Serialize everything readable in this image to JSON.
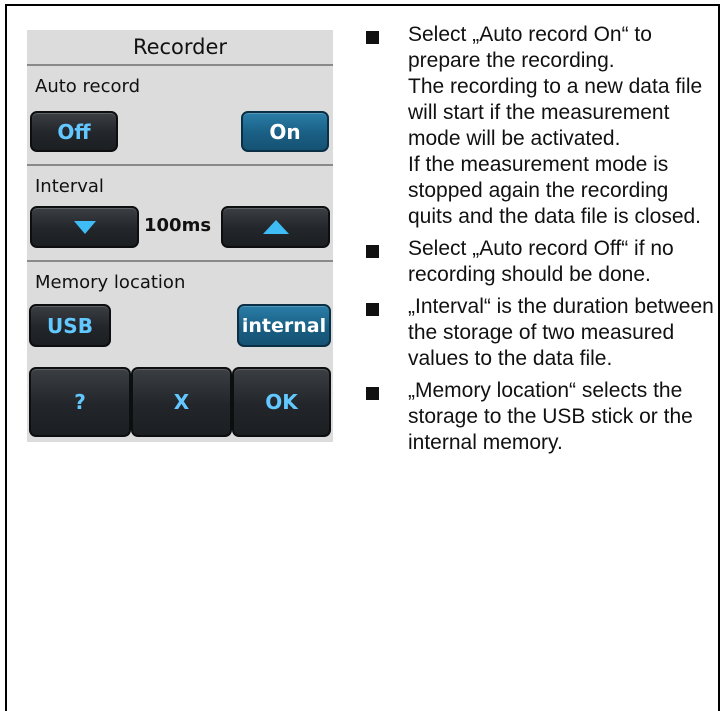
{
  "recorder": {
    "title": "Recorder",
    "auto_record": {
      "label": "Auto record",
      "off": "Off",
      "on": "On",
      "selected": "On"
    },
    "interval": {
      "label": "Interval",
      "value": "100ms",
      "down_icon": "arrow-down-icon",
      "up_icon": "arrow-up-icon"
    },
    "memory_location": {
      "label": "Memory location",
      "usb": "USB",
      "internal": "internal",
      "selected": "internal"
    },
    "footer": {
      "help": "?",
      "cancel": "X",
      "ok": "OK"
    }
  },
  "colors": {
    "button_text": "#63c8ff",
    "active_button": "#1a5f84",
    "screen_bg": "#dcdcdc"
  },
  "instructions": {
    "items": [
      {
        "lines": [
          "Select „Auto record On“ to prepare the recording.",
          "The recording to a new data file will start if the measurement mode will be activated.",
          "If the measurement mode is stopped again the recording quits and the data file is closed."
        ]
      },
      {
        "lines": [
          "Select „Auto record Off“ if no recording should be done."
        ]
      },
      {
        "lines": [
          "„Interval“ is the duration between the storage of two measured values to the data file."
        ]
      },
      {
        "lines": [
          "„Memory location“ selects the storage to the USB stick or the internal memory."
        ]
      }
    ]
  }
}
